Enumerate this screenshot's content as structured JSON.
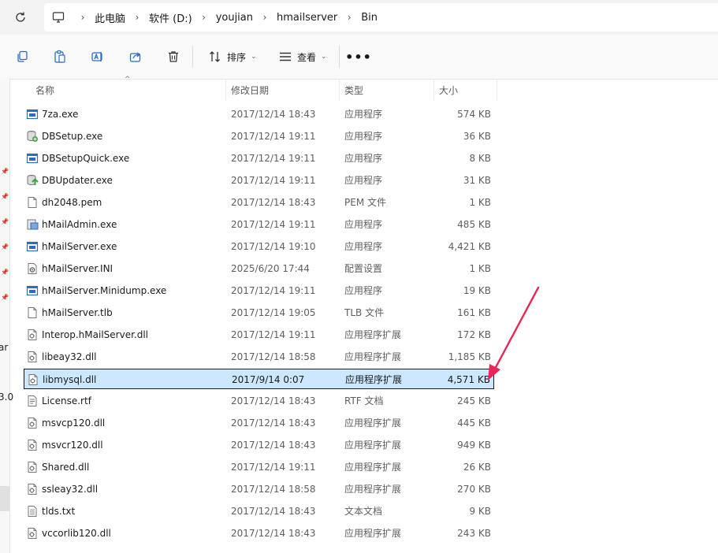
{
  "address": {
    "crumbs": [
      "此电脑",
      "软件 (D:)",
      "youjian",
      "hmailserver",
      "Bin"
    ]
  },
  "toolbar": {
    "sort_label": "排序",
    "view_label": "查看",
    "more_label": "•••"
  },
  "nav": {
    "clip_texts": [
      "ar",
      "3.0"
    ]
  },
  "columns": {
    "name": "名称",
    "modified": "修改日期",
    "type": "类型",
    "size": "大小"
  },
  "files": [
    {
      "name": "7za.exe",
      "date": "2017/12/14 18:43",
      "type": "应用程序",
      "size": "574 KB",
      "icon": "exe-icon"
    },
    {
      "name": "DBSetup.exe",
      "date": "2017/12/14 19:11",
      "type": "应用程序",
      "size": "36 KB",
      "icon": "db-setup-icon"
    },
    {
      "name": "DBSetupQuick.exe",
      "date": "2017/12/14 19:11",
      "type": "应用程序",
      "size": "8 KB",
      "icon": "exe-icon"
    },
    {
      "name": "DBUpdater.exe",
      "date": "2017/12/14 19:11",
      "type": "应用程序",
      "size": "31 KB",
      "icon": "db-updater-icon"
    },
    {
      "name": "dh2048.pem",
      "date": "2017/12/14 18:43",
      "type": "PEM 文件",
      "size": "1 KB",
      "icon": "file-icon"
    },
    {
      "name": "hMailAdmin.exe",
      "date": "2017/12/14 19:11",
      "type": "应用程序",
      "size": "485 KB",
      "icon": "admin-exe-icon"
    },
    {
      "name": "hMailServer.exe",
      "date": "2017/12/14 19:10",
      "type": "应用程序",
      "size": "4,421 KB",
      "icon": "exe-icon"
    },
    {
      "name": "hMailServer.INI",
      "date": "2025/6/20 17:44",
      "type": "配置设置",
      "size": "1 KB",
      "icon": "ini-icon"
    },
    {
      "name": "hMailServer.Minidump.exe",
      "date": "2017/12/14 19:11",
      "type": "应用程序",
      "size": "19 KB",
      "icon": "exe-icon"
    },
    {
      "name": "hMailServer.tlb",
      "date": "2017/12/14 19:05",
      "type": "TLB 文件",
      "size": "161 KB",
      "icon": "file-icon"
    },
    {
      "name": "Interop.hMailServer.dll",
      "date": "2017/12/14 19:11",
      "type": "应用程序扩展",
      "size": "172 KB",
      "icon": "dll-icon"
    },
    {
      "name": "libeay32.dll",
      "date": "2017/12/14 18:58",
      "type": "应用程序扩展",
      "size": "1,185 KB",
      "icon": "dll-icon"
    },
    {
      "name": "libmysql.dll",
      "date": "2017/9/14 0:07",
      "type": "应用程序扩展",
      "size": "4,571 KB",
      "icon": "dll-icon",
      "selected": true
    },
    {
      "name": "License.rtf",
      "date": "2017/12/14 18:43",
      "type": "RTF 文档",
      "size": "245 KB",
      "icon": "rtf-icon"
    },
    {
      "name": "msvcp120.dll",
      "date": "2017/12/14 18:43",
      "type": "应用程序扩展",
      "size": "445 KB",
      "icon": "dll-icon"
    },
    {
      "name": "msvcr120.dll",
      "date": "2017/12/14 18:43",
      "type": "应用程序扩展",
      "size": "949 KB",
      "icon": "dll-icon"
    },
    {
      "name": "Shared.dll",
      "date": "2017/12/14 19:11",
      "type": "应用程序扩展",
      "size": "26 KB",
      "icon": "dll-icon"
    },
    {
      "name": "ssleay32.dll",
      "date": "2017/12/14 18:58",
      "type": "应用程序扩展",
      "size": "270 KB",
      "icon": "dll-icon"
    },
    {
      "name": "tlds.txt",
      "date": "2017/12/14 18:43",
      "type": "文本文档",
      "size": "9 KB",
      "icon": "txt-icon"
    },
    {
      "name": "vccorlib120.dll",
      "date": "2017/12/14 18:43",
      "type": "应用程序扩展",
      "size": "243 KB",
      "icon": "dll-icon"
    }
  ],
  "colors": {
    "selection_bg": "#cce8ff",
    "annotation_arrow": "#e8265a",
    "exe_blue": "#2b6cc4"
  }
}
